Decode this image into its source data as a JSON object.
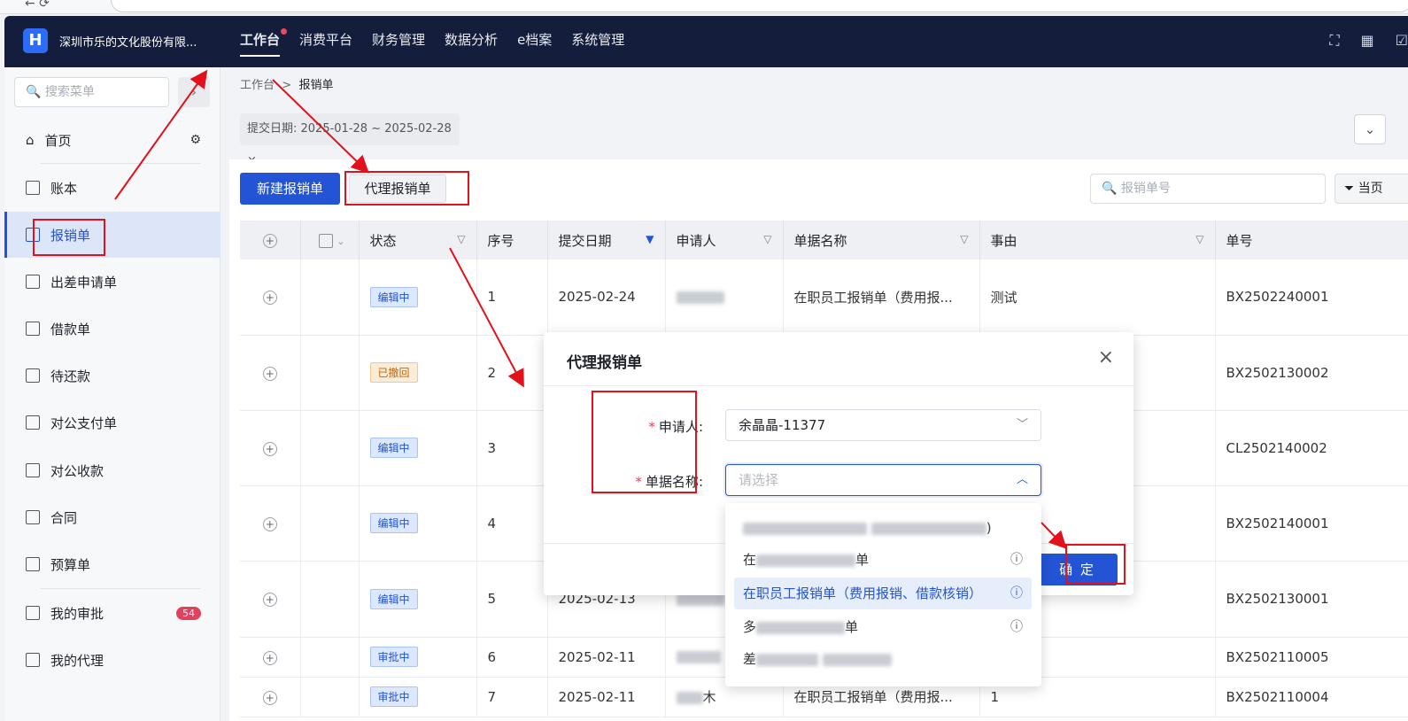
{
  "header": {
    "logo_text": "H",
    "company": "深圳市乐的文化股份有限...",
    "nav": [
      {
        "label": "工作台",
        "active": true,
        "dot": true
      },
      {
        "label": "消费平台"
      },
      {
        "label": "财务管理"
      },
      {
        "label": "数据分析"
      },
      {
        "label": "e档案"
      },
      {
        "label": "系统管理"
      }
    ]
  },
  "sidebar": {
    "search_placeholder": "搜索菜单",
    "items": [
      {
        "label": "首页"
      },
      {
        "label": "账本"
      },
      {
        "label": "报销单",
        "active": true
      },
      {
        "label": "出差申请单"
      },
      {
        "label": "借款单"
      },
      {
        "label": "待还款"
      },
      {
        "label": "对公支付单"
      },
      {
        "label": "对公收款"
      },
      {
        "label": "合同"
      },
      {
        "label": "预算单"
      },
      {
        "label": "我的审批",
        "badge": "54"
      },
      {
        "label": "我的代理"
      }
    ]
  },
  "breadcrumb": {
    "root": "工作台",
    "sep": ">",
    "current": "报销单"
  },
  "filter_tag": "提交日期: 2025-01-28 ~ 2025-02-28",
  "filter_tag_close": "×",
  "toolbar": {
    "new_label": "新建报销单",
    "proxy_label": "代理报销单",
    "search_placeholder": "报销单号",
    "filter_page_label": "当页"
  },
  "table": {
    "headers": [
      "状态",
      "序号",
      "提交日期",
      "申请人",
      "单据名称",
      "事由",
      "单号"
    ],
    "rows": [
      {
        "status": "编辑中",
        "status_color": "blue",
        "seq": "1",
        "date": "2025-02-24",
        "name": "在职员工报销单（费用报...",
        "reason": "测试",
        "no": "BX2502240001"
      },
      {
        "status": "已撤回",
        "status_color": "orange",
        "seq": "2",
        "date": "",
        "name": "",
        "reason": "",
        "no": "BX2502130002"
      },
      {
        "status": "编辑中",
        "status_color": "blue",
        "seq": "3",
        "date": "",
        "name": "",
        "reason": "",
        "no": "CL2502140002"
      },
      {
        "status": "编辑中",
        "status_color": "blue",
        "seq": "4",
        "date": "",
        "name": "",
        "reason": "",
        "no": "BX2502140001"
      },
      {
        "status": "编辑中",
        "status_color": "blue",
        "seq": "5",
        "date": "2025-02-13",
        "name": "",
        "reason": "",
        "no": "BX2502130001"
      },
      {
        "status": "审批中",
        "status_color": "blue",
        "seq": "6",
        "date": "2025-02-11",
        "name": "",
        "reason": "",
        "no": "BX2502110005"
      },
      {
        "status": "审批中",
        "status_color": "blue",
        "seq": "7",
        "date": "2025-02-11",
        "applicant_tail": "木",
        "name": "在职员工报销单（费用报...",
        "reason": "1",
        "no": "BX2502110004"
      }
    ]
  },
  "modal": {
    "title": "代理报销单",
    "close": "×",
    "applicant_label": "申请人",
    "applicant_value": "余晶晶-11377",
    "doc_label": "单据名称",
    "doc_placeholder": "请选择",
    "confirm_label": "确 定",
    "colon": ":"
  },
  "dropdown": {
    "items": [
      {
        "label": ")",
        "blurred": true
      },
      {
        "label": "单",
        "blurred": true,
        "prefix": "在",
        "info": true
      },
      {
        "label": "在职员工报销单（费用报销、借款核销）",
        "selected": true,
        "info": true
      },
      {
        "label": "单",
        "blurred": true,
        "prefix": "多",
        "info": true
      },
      {
        "label": "",
        "blurred": true,
        "prefix": "差"
      }
    ]
  },
  "colors": {
    "primary": "#2454d6",
    "topbar": "#141d3b",
    "annotation": "#e3111c"
  }
}
